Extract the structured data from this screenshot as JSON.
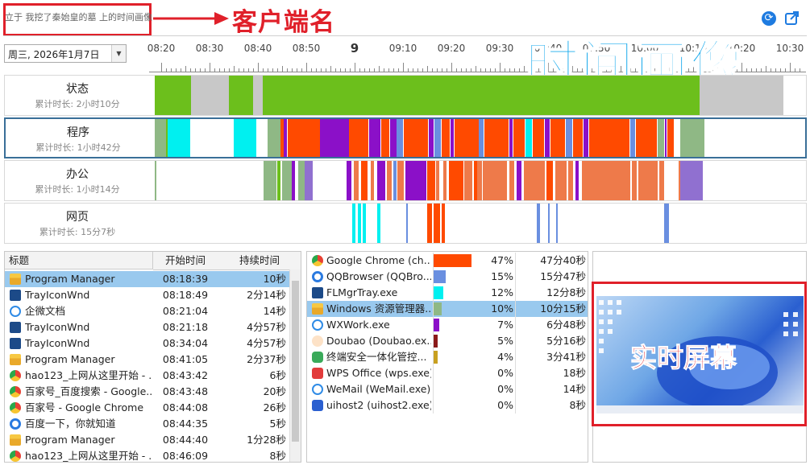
{
  "header": {
    "client_name_text": "立于 我挖了秦始皇的墓 上的时间画像",
    "client_label": "客户端名",
    "big_title": "时间画像"
  },
  "date_select": {
    "value": "周三, 2026年1月7日"
  },
  "axis": {
    "labels": [
      "08:20",
      "08:30",
      "08:40",
      "08:50",
      "9",
      "09:10",
      "09:20",
      "09:30",
      "09:40",
      "09:50",
      "10:00",
      "10:10",
      "10:20",
      "10:30"
    ]
  },
  "rows": [
    {
      "title": "状态",
      "sub": "累计时长: 2小时10分"
    },
    {
      "title": "程序",
      "sub": "累计时长: 1小时42分"
    },
    {
      "title": "办公",
      "sub": "累计时长: 1小时14分"
    },
    {
      "title": "网页",
      "sub": "累计时长: 15分7秒"
    }
  ],
  "colors": {
    "active": "#6cbf1c",
    "idle": "#c8c8c8",
    "cyan": "#00f0f0",
    "orange": "#ff4a00",
    "purple": "#8b10c8",
    "sage": "#8fb885",
    "blue": "#6a8fe0",
    "salmon": "#ee7a4a",
    "lavender": "#9070d0"
  },
  "title_table": {
    "headers": [
      "标题",
      "开始时间",
      "持续时间"
    ],
    "rows": [
      {
        "icon": "folder-icon",
        "title": "Program Manager",
        "start": "08:18:39",
        "duration": "10秒"
      },
      {
        "icon": "app-icon",
        "title": "TrayIconWnd",
        "start": "08:18:49",
        "duration": "2分14秒"
      },
      {
        "icon": "wechat-icon",
        "title": "企微文档",
        "start": "08:21:04",
        "duration": "14秒"
      },
      {
        "icon": "app-icon",
        "title": "TrayIconWnd",
        "start": "08:21:18",
        "duration": "4分57秒"
      },
      {
        "icon": "app-icon",
        "title": "TrayIconWnd",
        "start": "08:34:04",
        "duration": "4分57秒"
      },
      {
        "icon": "folder-icon",
        "title": "Program Manager",
        "start": "08:41:05",
        "duration": "2分37秒"
      },
      {
        "icon": "chrome-icon",
        "title": "hao123_上网从这里开始 - ...",
        "start": "08:43:42",
        "duration": "6秒"
      },
      {
        "icon": "chrome-icon",
        "title": "百家号_百度搜索 - Google...",
        "start": "08:43:48",
        "duration": "20秒"
      },
      {
        "icon": "chrome-icon",
        "title": "百家号 - Google Chrome",
        "start": "08:44:08",
        "duration": "26秒"
      },
      {
        "icon": "qq-icon",
        "title": "百度一下，你就知道",
        "start": "08:44:35",
        "duration": "5秒"
      },
      {
        "icon": "folder-icon",
        "title": "Program Manager",
        "start": "08:44:40",
        "duration": "1分28秒"
      },
      {
        "icon": "chrome-icon",
        "title": "hao123_上网从这里开始 - ...",
        "start": "08:46:09",
        "duration": "8秒"
      }
    ]
  },
  "proc_table": {
    "rows": [
      {
        "icon": "chrome-icon",
        "name": "Google Chrome (ch...",
        "pct": "47%",
        "frac": 0.47,
        "duration": "47分40秒",
        "color": "#ff4a00"
      },
      {
        "icon": "qq-icon",
        "name": "QQBrowser (QQBro...",
        "pct": "15%",
        "frac": 0.15,
        "duration": "15分47秒",
        "color": "#6a8fe0"
      },
      {
        "icon": "app-icon",
        "name": "FLMgrTray.exe",
        "pct": "12%",
        "frac": 0.12,
        "duration": "12分8秒",
        "color": "#00f0f0"
      },
      {
        "icon": "folder-icon",
        "name": "Windows 资源管理器...",
        "pct": "10%",
        "frac": 0.1,
        "duration": "10分15秒",
        "color": "#8fb885"
      },
      {
        "icon": "wechat-icon",
        "name": "WXWork.exe",
        "pct": "7%",
        "frac": 0.07,
        "duration": "6分48秒",
        "color": "#8b10c8"
      },
      {
        "icon": "doubao-icon",
        "name": "Doubao (Doubao.ex...",
        "pct": "5%",
        "frac": 0.05,
        "duration": "5分16秒",
        "color": "#8b1a1a"
      },
      {
        "icon": "security-icon",
        "name": "终端安全一体化管控...",
        "pct": "4%",
        "frac": 0.04,
        "duration": "3分41秒",
        "color": "#c8a020"
      },
      {
        "icon": "wps-icon",
        "name": "WPS Office (wps.exe)",
        "pct": "0%",
        "frac": 0.0,
        "duration": "18秒",
        "color": "#ee4444"
      },
      {
        "icon": "wechat-icon",
        "name": "WeMail (WeMail.exe)",
        "pct": "0%",
        "frac": 0.0,
        "duration": "14秒",
        "color": "#2a7ae0"
      },
      {
        "icon": "uihost-icon",
        "name": "uihost2 (uihost2.exe)",
        "pct": "0%",
        "frac": 0.0,
        "duration": "8秒",
        "color": "#2a5fd0"
      }
    ]
  },
  "screen": {
    "label": "实时屏幕"
  }
}
